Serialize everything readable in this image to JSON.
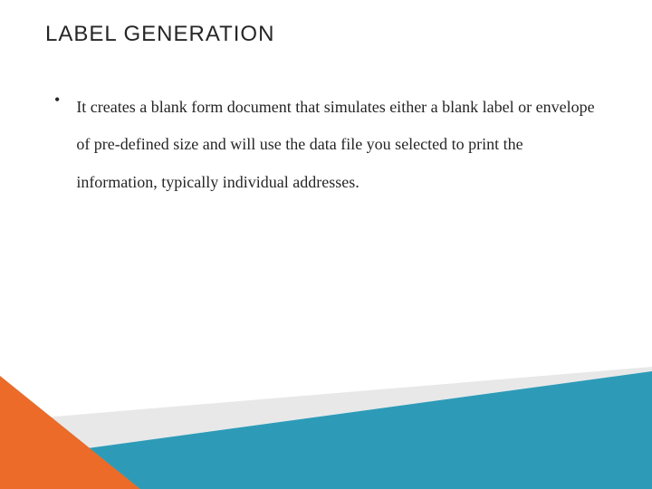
{
  "slide": {
    "title": "LABEL GENERATION",
    "bullets": [
      {
        "marker": "•",
        "text": "It creates a blank form document that simulates either a blank label or envelope of pre-defined size and will use the data file you selected to print the information, typically individual addresses."
      }
    ]
  },
  "colors": {
    "orange": "#EC6B28",
    "teal": "#2D9BB8",
    "gray": "#E8E8E8",
    "text": "#262626"
  }
}
